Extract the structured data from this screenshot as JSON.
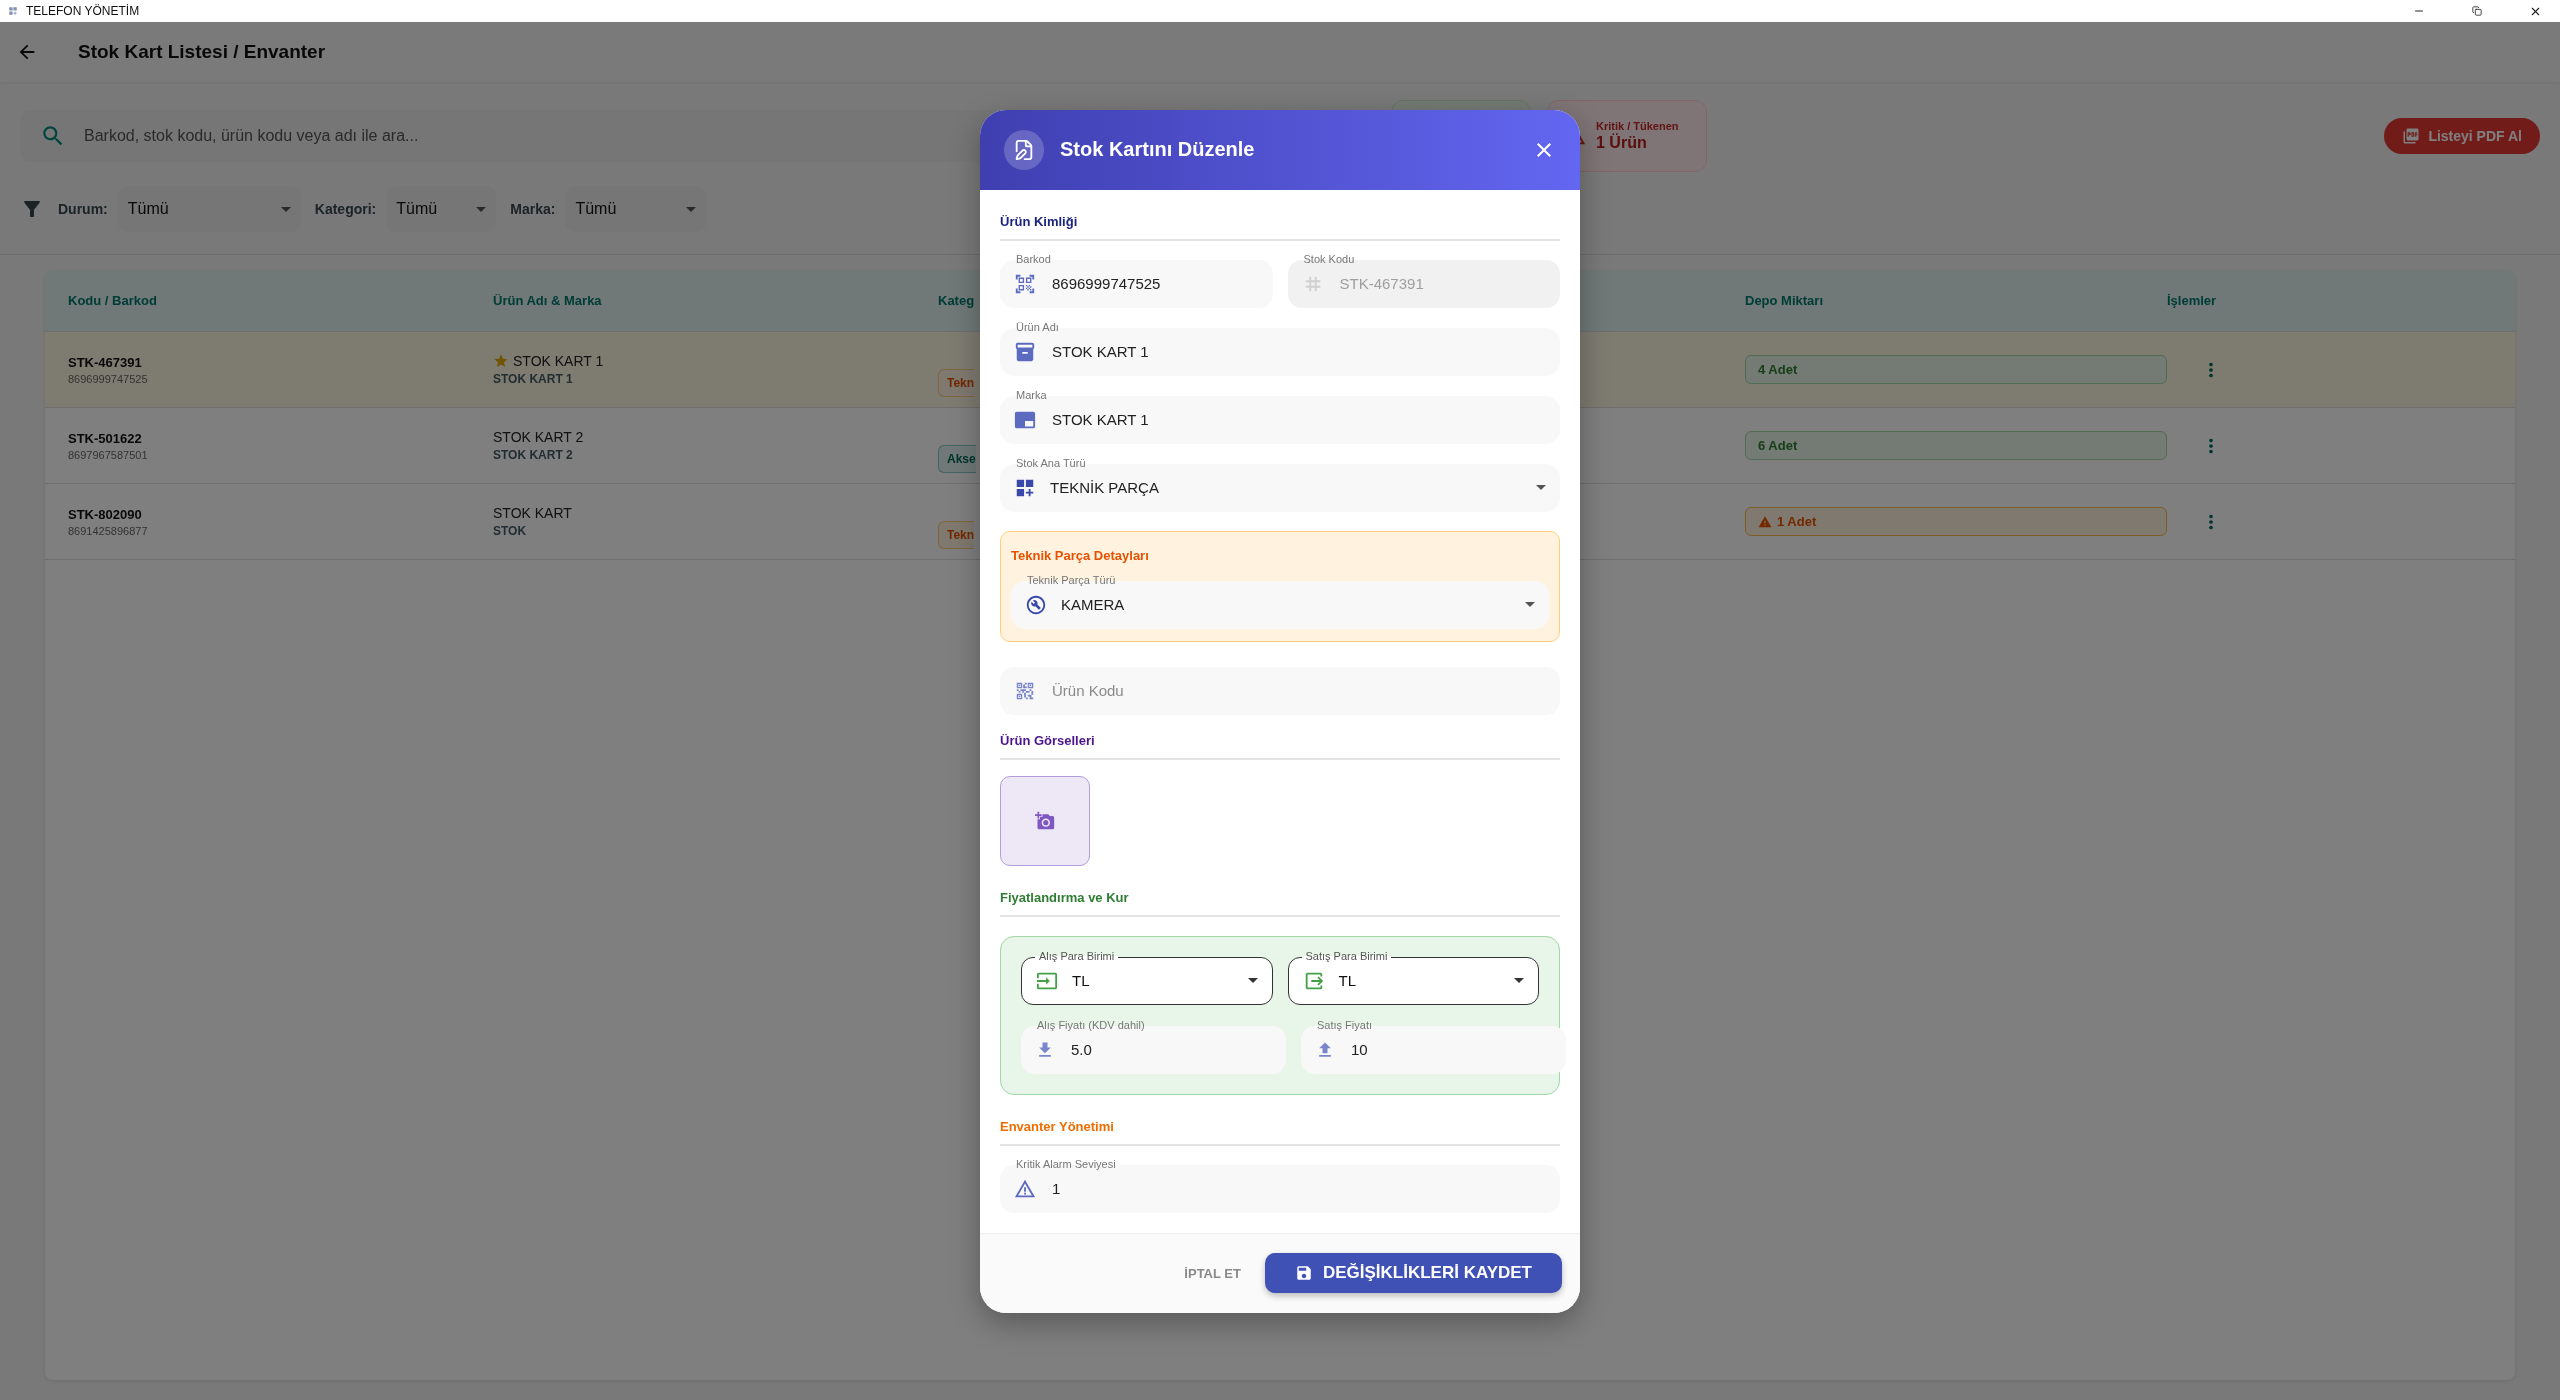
{
  "window": {
    "title": "TELEFON YÖNETİM"
  },
  "app_bar": {
    "title": "Stok Kart Listesi / Envanter"
  },
  "search": {
    "placeholder": "Barkod, stok kodu, ürün kodu veya adı ile ara..."
  },
  "stat_cards": [
    {
      "kind": "stock"
    },
    {
      "kind": "critical",
      "label": "Kritik / Tükenen",
      "value": "1 Ürün"
    }
  ],
  "pdf_button": {
    "label": "Listeyi PDF Al"
  },
  "filters": [
    {
      "label": "Durum:",
      "value": "Tümü"
    },
    {
      "label": "Kategori:",
      "value": "Tümü"
    },
    {
      "label": "Marka:",
      "value": "Tümü"
    }
  ],
  "table": {
    "columns": [
      "Kodu / Barkod",
      "Ürün Adı & Marka",
      "Kateg",
      "Depo Miktarı",
      "İşlemler"
    ],
    "rows": [
      {
        "selected": true,
        "code": "STK-467391",
        "barcode": "8696999747525",
        "starred": true,
        "name": "STOK KART 1",
        "brand": "STOK KART 1",
        "category": {
          "label": "Tekn",
          "kind": "technical"
        },
        "stock": {
          "label": "4 Adet",
          "kind": "ok"
        }
      },
      {
        "selected": false,
        "code": "STK-501622",
        "barcode": "8697967587501",
        "starred": false,
        "name": "STOK KART 2",
        "brand": "STOK KART 2",
        "category": {
          "label": "Akse",
          "kind": "accessory"
        },
        "stock": {
          "label": "6 Adet",
          "kind": "ok"
        }
      },
      {
        "selected": false,
        "code": "STK-802090",
        "barcode": "8691425896877",
        "starred": false,
        "name": "STOK KART",
        "brand": "STOK",
        "category": {
          "label": "Tekn",
          "kind": "technical"
        },
        "stock": {
          "label": "1 Adet",
          "kind": "low"
        }
      }
    ]
  },
  "dialog": {
    "title": "Stok Kartını Düzenle",
    "identity": {
      "title": "Ürün Kimliği",
      "barcode": {
        "label": "Barkod",
        "value": "8696999747525",
        "disabled": false
      },
      "stock_code": {
        "label": "Stok Kodu",
        "value": "STK-467391",
        "disabled": true
      },
      "name": {
        "label": "Ürün Adı",
        "value": "STOK KART 1"
      },
      "brand": {
        "label": "Marka",
        "value": "STOK KART 1"
      },
      "main_type": {
        "label": "Stok Ana Türü",
        "value": "TEKNİK PARÇA"
      }
    },
    "technical": {
      "title": "Teknik Parça Detayları",
      "part_type": {
        "label": "Teknik Parça Türü",
        "value": "KAMERA"
      }
    },
    "product_code": {
      "placeholder": "Ürün Kodu"
    },
    "images": {
      "title": "Ürün Görselleri"
    },
    "pricing": {
      "title": "Fiyatlandırma ve Kur",
      "buy_currency": {
        "label": "Alış Para Birimi",
        "value": "TL"
      },
      "sell_currency": {
        "label": "Satış Para Birimi",
        "value": "TL"
      },
      "buy_price": {
        "label": "Alış Fiyatı (KDV dahil)",
        "value": "5.0"
      },
      "sell_price": {
        "label": "Satış Fiyatı",
        "value": "10"
      }
    },
    "inventory": {
      "title": "Envanter Yönetimi",
      "alarm_level": {
        "label": "Kritik Alarm Seviyesi",
        "value": "1"
      }
    },
    "cancel_button": "İPTAL ET",
    "save_button": "DEĞİŞİKLİKLERİ KAYDET"
  }
}
